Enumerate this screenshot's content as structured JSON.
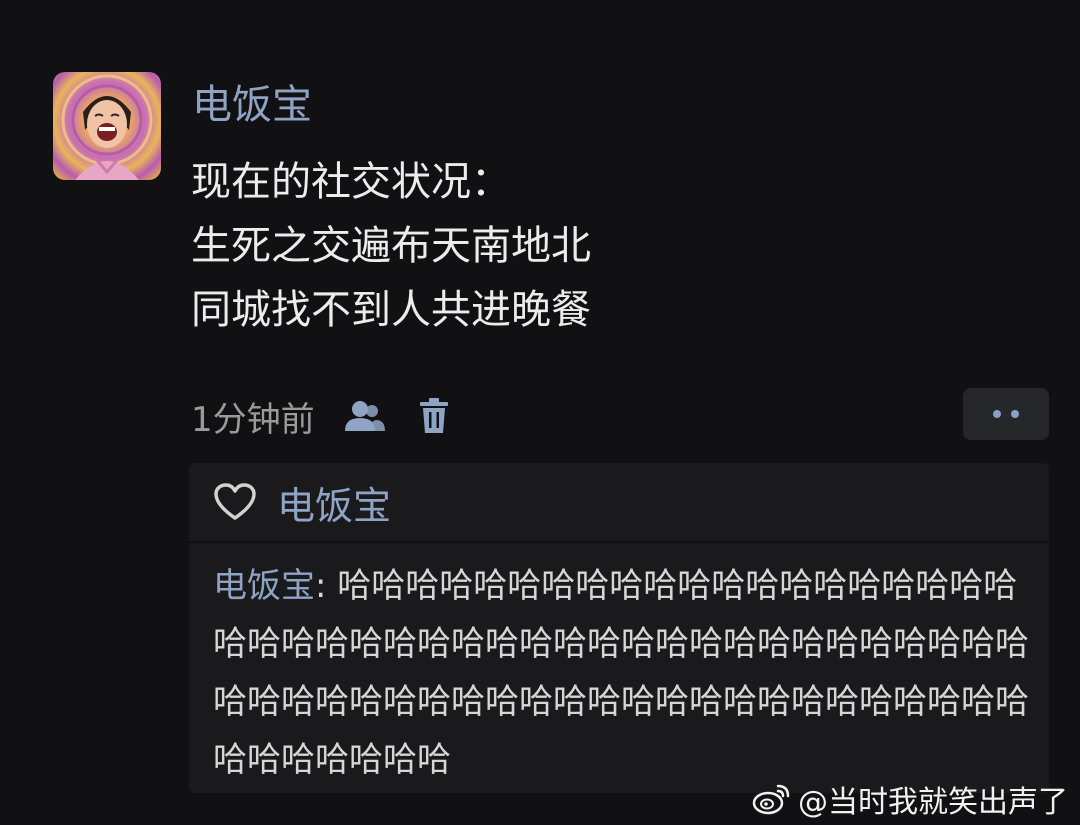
{
  "post": {
    "username": "电饭宝",
    "lines": [
      "现在的社交状况：",
      "生死之交遍布天南地北",
      "同城找不到人共进晚餐"
    ],
    "time": "1分钟前",
    "icons": {
      "visibility": "people-icon",
      "delete": "trash-icon",
      "more": "more-dots-icon"
    }
  },
  "likes": {
    "icon": "heart-icon",
    "users": "电饭宝"
  },
  "comment": {
    "author": "电饭宝",
    "separator": ": ",
    "text": "哈哈哈哈哈哈哈哈哈哈哈哈哈哈哈哈哈哈哈哈哈哈哈哈哈哈哈哈哈哈哈哈哈哈哈哈哈哈哈哈哈哈哈哈哈哈哈哈哈哈哈哈哈哈哈哈哈哈哈哈哈哈哈哈哈哈哈哈哈哈哈哈哈哈哈"
  },
  "watermark": {
    "icon": "weibo-icon",
    "text": "@当时我就笑出声了"
  },
  "colors": {
    "background": "#111113",
    "name_link": "#8fa4c4",
    "text": "#ececec",
    "muted": "#9a9a9a",
    "panel": "#1a1a1c"
  }
}
